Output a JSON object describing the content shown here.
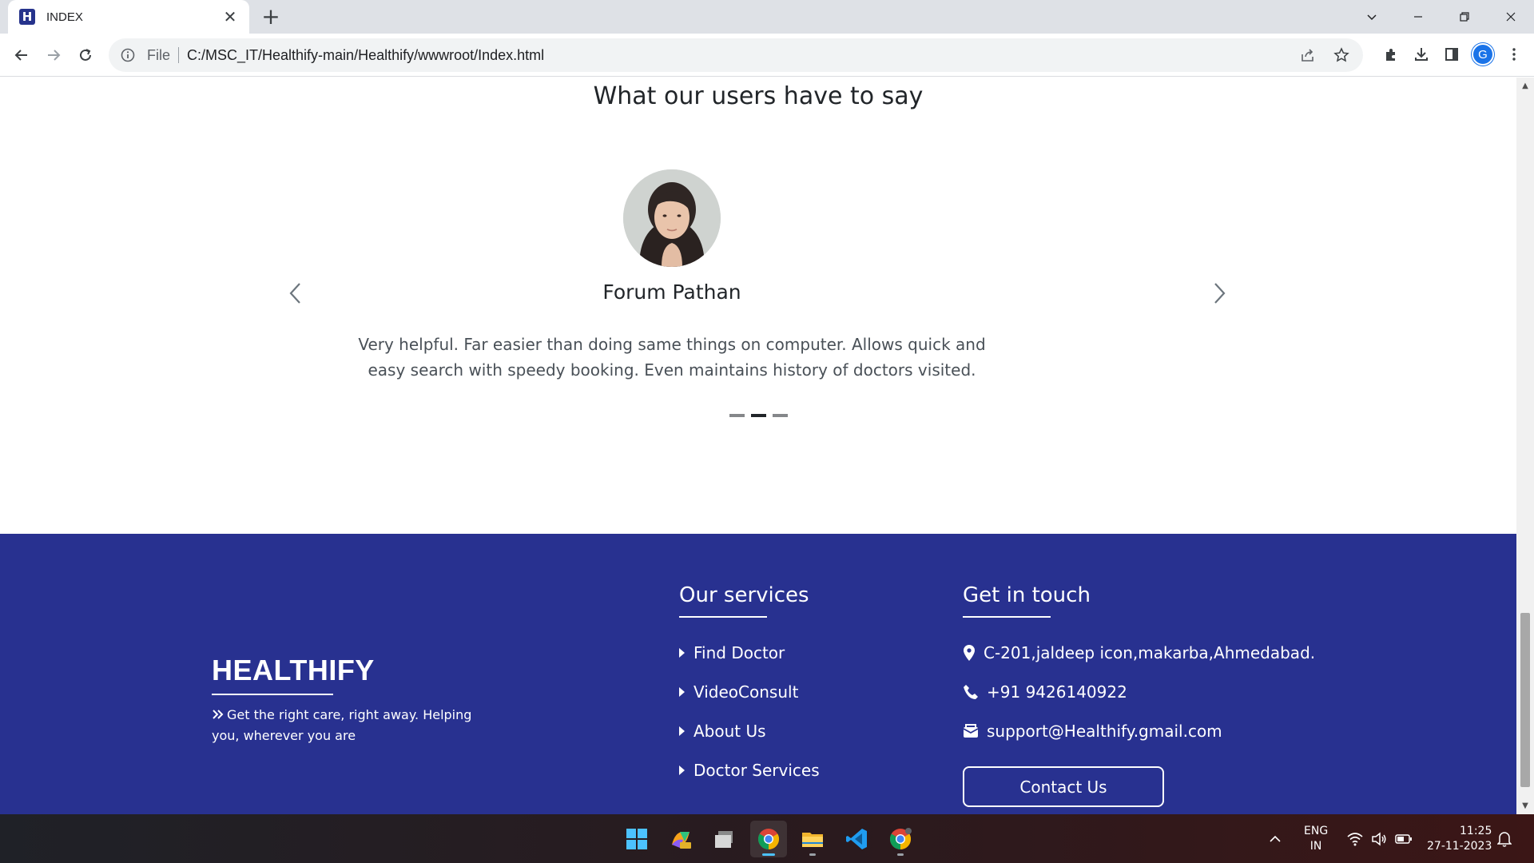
{
  "browser": {
    "tab_title": "INDEX",
    "favicon_letter": "H",
    "url_scheme_label": "File",
    "url": "C:/MSC_IT/Healthify-main/Healthify/wwwroot/Index.html",
    "profile_initial": "G"
  },
  "testimonials": {
    "heading": "What our users have to say",
    "name": "Forum Pathan",
    "quote": "Very helpful. Far easier than doing same things on computer. Allows quick and easy search with speedy booking. Even maintains history of doctors visited.",
    "slide_count": 3,
    "active_slide": 2
  },
  "footer": {
    "brand": "HEALTHIFY",
    "tagline": "Get the right care, right away. Helping you, wherever you are",
    "services_heading": "Our services",
    "services": [
      "Find Doctor",
      "VideoConsult",
      "About Us",
      "Doctor Services"
    ],
    "contact_heading": "Get in touch",
    "address": "C-201,jaldeep icon,makarba,Ahmedabad.",
    "phone": "+91 9426140922",
    "email": "support@Healthify.gmail.com",
    "contact_button": "Contact Us",
    "background_color": "#283190"
  },
  "taskbar": {
    "apps": [
      "start-icon",
      "copilot-icon",
      "task-view-icon",
      "chrome-icon",
      "file-explorer-icon",
      "vscode-icon",
      "chrome-canary-icon"
    ],
    "lang_line1": "ENG",
    "lang_line2": "IN",
    "time": "11:25",
    "date": "27-11-2023"
  }
}
